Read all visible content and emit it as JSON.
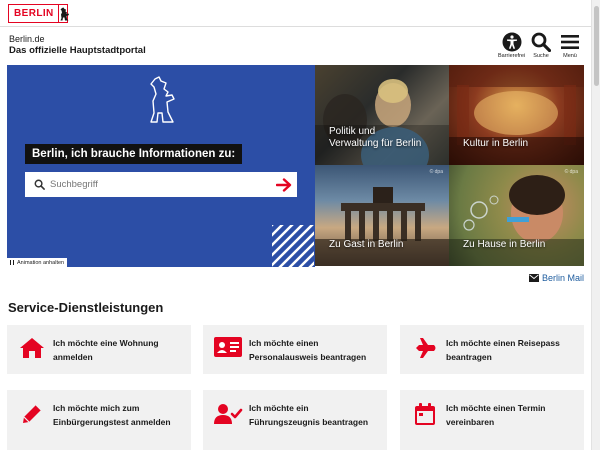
{
  "topbar": {
    "logo_text": "BERLIN"
  },
  "header": {
    "site_name": "Berlin.de",
    "site_subtitle": "Das offizielle Hauptstadtportal",
    "buttons": [
      {
        "label": "Barrierefrei",
        "icon": "accessibility-icon"
      },
      {
        "label": "Suche",
        "icon": "search-icon"
      },
      {
        "label": "Menü",
        "icon": "menu-icon"
      }
    ]
  },
  "hero": {
    "label": "Berlin, ich brauche Informationen zu:",
    "search": {
      "placeholder": "Suchbegriff",
      "value": ""
    },
    "animation_toggle": "Animation anhalten"
  },
  "tiles": [
    {
      "title": "Politik und\nVerwaltung für Berlin",
      "credit": ""
    },
    {
      "title": "Kultur in Berlin",
      "credit": ""
    },
    {
      "title": "Zu Gast in Berlin",
      "credit": "© dpa"
    },
    {
      "title": "Zu Hause in Berlin",
      "credit": "© dpa"
    }
  ],
  "mail_link": "Berlin Mail",
  "services": {
    "title": "Service-Dienstleistungen",
    "items": [
      {
        "label": "Ich möchte eine Wohnung anmelden",
        "icon": "house-icon"
      },
      {
        "label": "Ich möchte einen Personalausweis beantragen",
        "icon": "id-card-icon"
      },
      {
        "label": "Ich möchte einen Reisepass beantragen",
        "icon": "airplane-icon"
      },
      {
        "label": "Ich möchte mich zum Einbürgerungstest anmelden",
        "icon": "pencil-icon"
      },
      {
        "label": "Ich möchte ein Führungszeugnis beantragen",
        "icon": "user-check-icon"
      },
      {
        "label": "Ich möchte einen Termin vereinbaren",
        "icon": "calendar-icon"
      }
    ]
  },
  "colors": {
    "brand_red": "#e40422",
    "hero_blue": "#2c4ea6",
    "link_blue": "#1f5d9f"
  }
}
